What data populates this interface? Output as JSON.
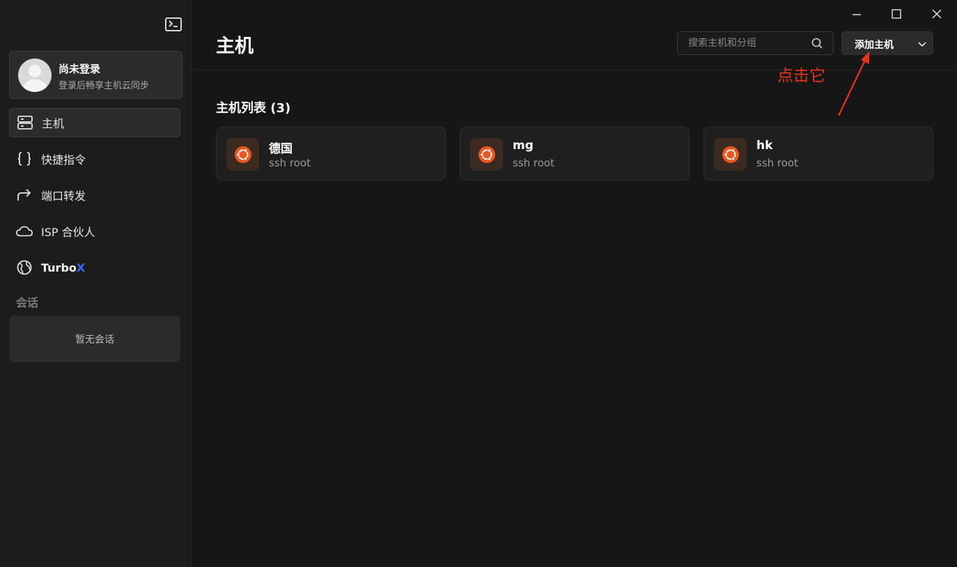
{
  "sidebar": {
    "terminal_icon": "terminal-icon",
    "user": {
      "name": "尚未登录",
      "subtitle": "登录后畅享主机云同步"
    },
    "items": [
      {
        "label": "主机",
        "icon": "server-icon",
        "active": true
      },
      {
        "label": "快捷指令",
        "icon": "braces-icon",
        "active": false
      },
      {
        "label": "端口转发",
        "icon": "forward-arrow-icon",
        "active": false
      },
      {
        "label": "ISP 合伙人",
        "icon": "cloud-icon",
        "active": false
      }
    ],
    "turbo": {
      "label_main": "Turbo",
      "label_accent": "X",
      "icon": "globe-icon"
    },
    "sessions_title": "会话",
    "sessions_empty": "暂无会话"
  },
  "main": {
    "title": "主机",
    "search_placeholder": "搜索主机和分组",
    "add_button": "添加主机",
    "annotation": "点击它",
    "list_title": "主机列表 (3)",
    "hosts": [
      {
        "name": "德国",
        "sub": "ssh root",
        "icon": "ubuntu-icon"
      },
      {
        "name": "mg",
        "sub": "ssh root",
        "icon": "ubuntu-icon"
      },
      {
        "name": "hk",
        "sub": "ssh root",
        "icon": "ubuntu-icon"
      }
    ]
  },
  "colors": {
    "background": "#161616",
    "sidebar": "#1c1c1c",
    "card": "#1f1f1f",
    "accent_blue": "#2f6df6",
    "annotation_red": "#e8331c",
    "ubuntu_orange": "#e9571f"
  }
}
